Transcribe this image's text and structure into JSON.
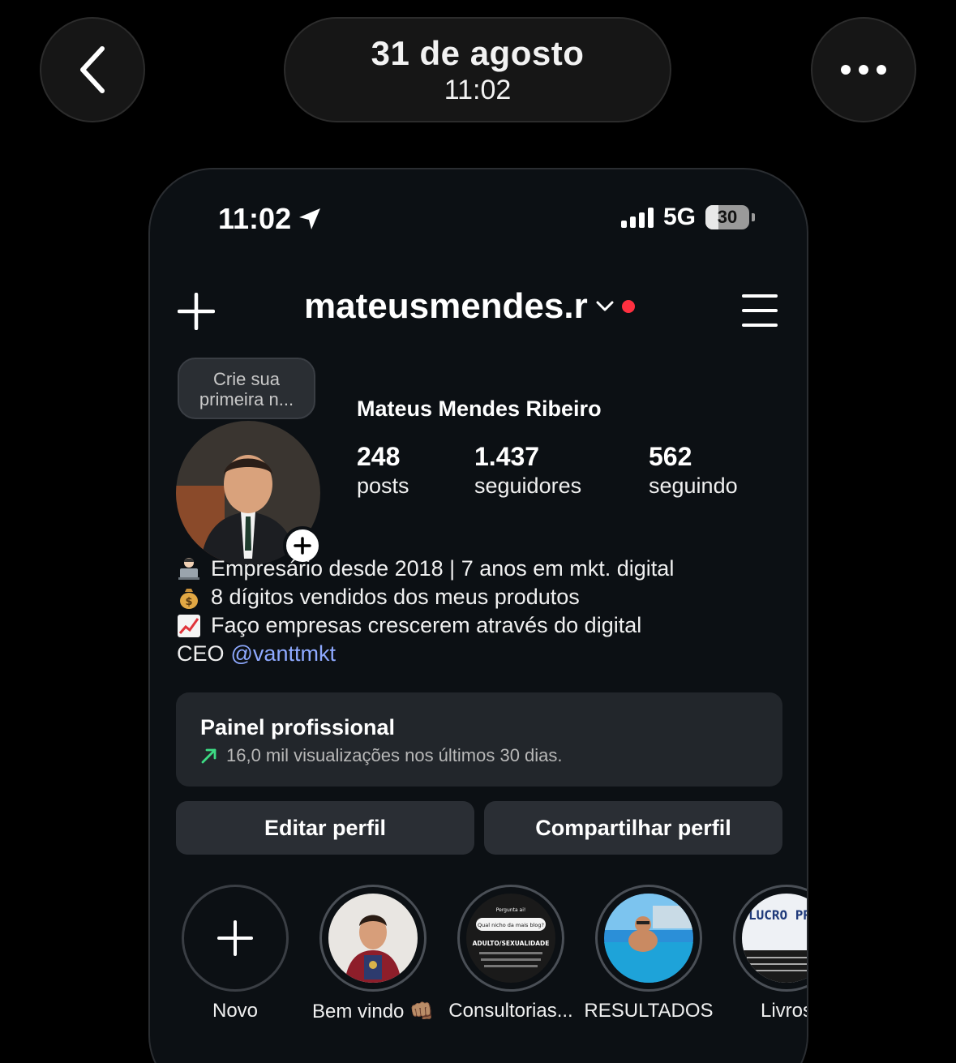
{
  "viewer": {
    "date": "31 de agosto",
    "time": "11:02",
    "back_icon": "chevron-left-icon",
    "more_icon": "ellipsis-icon"
  },
  "status_bar": {
    "time": "11:02",
    "network": "5G",
    "battery": "30",
    "battery_level_percent": 30
  },
  "profile": {
    "username": "mateusmendes.r",
    "full_name": "Mateus Mendes Ribeiro",
    "note": "Crie sua primeira n...",
    "stats": [
      {
        "value": "248",
        "label": "posts"
      },
      {
        "value": "1.437",
        "label": "seguidores"
      },
      {
        "value": "562",
        "label": "seguindo"
      }
    ],
    "bio": [
      {
        "emoji": "laptop-person-emoji",
        "text": "Empresário desde 2018 | 7 anos em mkt. digital"
      },
      {
        "emoji": "money-bag-emoji",
        "text": "8 dígitos vendidos dos meus produtos"
      },
      {
        "emoji": "chart-increasing-emoji",
        "text": "Faço empresas crescerem através do digital"
      }
    ],
    "bio_ceo_prefix": "CEO",
    "bio_mention": "@vanttmkt"
  },
  "dashboard": {
    "title": "Painel profissional",
    "subtitle": "16,0 mil visualizações nos últimos 30 dias."
  },
  "actions": {
    "edit": "Editar perfil",
    "share": "Compartilhar perfil"
  },
  "highlights": [
    {
      "label": "Novo"
    },
    {
      "label": "Bem vindo 👊🏽"
    },
    {
      "label": "Consultorias..."
    },
    {
      "label": "RESULTADOS"
    },
    {
      "label": "Livros"
    }
  ],
  "highlight_thumb_text": {
    "consultorias_q": "Qual nicho da mais blog?",
    "consultorias_top": "Pergunta ai!",
    "consultorias_tag": "ADULTO/SEXUALIDADE",
    "livros_title": "LUCRO PRIMEIRO"
  },
  "colors": {
    "background": "#000000",
    "phone_bg": "#0c1014",
    "accent_link": "#8ea9ff",
    "notification_dot": "#ff3040",
    "trend_green": "#3ddc84"
  }
}
